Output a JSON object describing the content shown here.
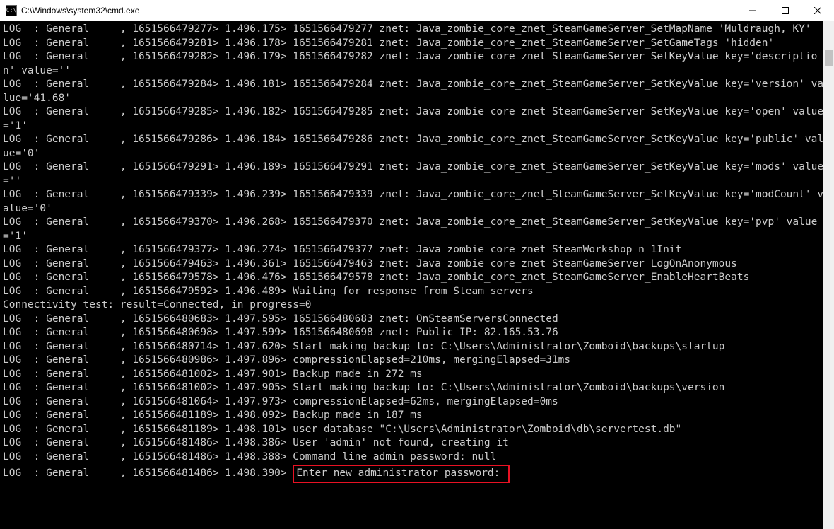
{
  "window": {
    "icon_label": "C:\\",
    "title": "C:\\Windows\\system32\\cmd.exe"
  },
  "log": {
    "lines": [
      "LOG  : General     , 1651566479277> 1.496.175> 1651566479277 znet: Java_zombie_core_znet_SteamGameServer_SetMapName 'Muldraugh, KY'",
      "LOG  : General     , 1651566479281> 1.496.178> 1651566479281 znet: Java_zombie_core_znet_SteamGameServer_SetGameTags 'hidden'",
      "LOG  : General     , 1651566479282> 1.496.179> 1651566479282 znet: Java_zombie_core_znet_SteamGameServer_SetKeyValue key='description' value=''",
      "LOG  : General     , 1651566479284> 1.496.181> 1651566479284 znet: Java_zombie_core_znet_SteamGameServer_SetKeyValue key='version' value='41.68'",
      "LOG  : General     , 1651566479285> 1.496.182> 1651566479285 znet: Java_zombie_core_znet_SteamGameServer_SetKeyValue key='open' value='1'",
      "LOG  : General     , 1651566479286> 1.496.184> 1651566479286 znet: Java_zombie_core_znet_SteamGameServer_SetKeyValue key='public' value='0'",
      "LOG  : General     , 1651566479291> 1.496.189> 1651566479291 znet: Java_zombie_core_znet_SteamGameServer_SetKeyValue key='mods' value=''",
      "LOG  : General     , 1651566479339> 1.496.239> 1651566479339 znet: Java_zombie_core_znet_SteamGameServer_SetKeyValue key='modCount' value='0'",
      "LOG  : General     , 1651566479370> 1.496.268> 1651566479370 znet: Java_zombie_core_znet_SteamGameServer_SetKeyValue key='pvp' value='1'",
      "LOG  : General     , 1651566479377> 1.496.274> 1651566479377 znet: Java_zombie_core_znet_SteamWorkshop_n_1Init",
      "LOG  : General     , 1651566479463> 1.496.361> 1651566479463 znet: Java_zombie_core_znet_SteamGameServer_LogOnAnonymous",
      "LOG  : General     , 1651566479578> 1.496.476> 1651566479578 znet: Java_zombie_core_znet_SteamGameServer_EnableHeartBeats",
      "LOG  : General     , 1651566479592> 1.496.489> Waiting for response from Steam servers",
      "Connectivity test: result=Connected, in progress=0",
      "LOG  : General     , 1651566480683> 1.497.595> 1651566480683 znet: OnSteamServersConnected",
      "LOG  : General     , 1651566480698> 1.497.599> 1651566480698 znet: Public IP: 82.165.53.76",
      "LOG  : General     , 1651566480714> 1.497.620> Start making backup to: C:\\Users\\Administrator\\Zomboid\\backups\\startup",
      "LOG  : General     , 1651566480986> 1.497.896> compressionElapsed=210ms, mergingElapsed=31ms",
      "LOG  : General     , 1651566481002> 1.497.901> Backup made in 272 ms",
      "LOG  : General     , 1651566481002> 1.497.905> Start making backup to: C:\\Users\\Administrator\\Zomboid\\backups\\version",
      "LOG  : General     , 1651566481064> 1.497.973> compressionElapsed=62ms, mergingElapsed=0ms",
      "LOG  : General     , 1651566481189> 1.498.092> Backup made in 187 ms",
      "LOG  : General     , 1651566481189> 1.498.101> user database \"C:\\Users\\Administrator\\Zomboid\\db\\servertest.db\"",
      "LOG  : General     , 1651566481486> 1.498.386> User 'admin' not found, creating it",
      "LOG  : General     , 1651566481486> 1.498.388> Command line admin password: null"
    ],
    "last_prefix": "LOG  : General     , 1651566481486> 1.498.390> ",
    "last_highlight": "Enter new administrator password: "
  }
}
